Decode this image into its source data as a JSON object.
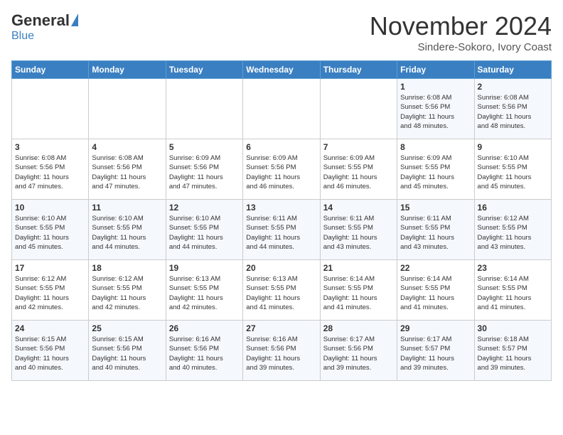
{
  "header": {
    "logo_general": "General",
    "logo_blue": "Blue",
    "month_title": "November 2024",
    "location": "Sindere-Sokoro, Ivory Coast"
  },
  "days_of_week": [
    "Sunday",
    "Monday",
    "Tuesday",
    "Wednesday",
    "Thursday",
    "Friday",
    "Saturday"
  ],
  "weeks": [
    [
      {
        "day": "",
        "info": ""
      },
      {
        "day": "",
        "info": ""
      },
      {
        "day": "",
        "info": ""
      },
      {
        "day": "",
        "info": ""
      },
      {
        "day": "",
        "info": ""
      },
      {
        "day": "1",
        "info": "Sunrise: 6:08 AM\nSunset: 5:56 PM\nDaylight: 11 hours\nand 48 minutes."
      },
      {
        "day": "2",
        "info": "Sunrise: 6:08 AM\nSunset: 5:56 PM\nDaylight: 11 hours\nand 48 minutes."
      }
    ],
    [
      {
        "day": "3",
        "info": "Sunrise: 6:08 AM\nSunset: 5:56 PM\nDaylight: 11 hours\nand 47 minutes."
      },
      {
        "day": "4",
        "info": "Sunrise: 6:08 AM\nSunset: 5:56 PM\nDaylight: 11 hours\nand 47 minutes."
      },
      {
        "day": "5",
        "info": "Sunrise: 6:09 AM\nSunset: 5:56 PM\nDaylight: 11 hours\nand 47 minutes."
      },
      {
        "day": "6",
        "info": "Sunrise: 6:09 AM\nSunset: 5:56 PM\nDaylight: 11 hours\nand 46 minutes."
      },
      {
        "day": "7",
        "info": "Sunrise: 6:09 AM\nSunset: 5:55 PM\nDaylight: 11 hours\nand 46 minutes."
      },
      {
        "day": "8",
        "info": "Sunrise: 6:09 AM\nSunset: 5:55 PM\nDaylight: 11 hours\nand 45 minutes."
      },
      {
        "day": "9",
        "info": "Sunrise: 6:10 AM\nSunset: 5:55 PM\nDaylight: 11 hours\nand 45 minutes."
      }
    ],
    [
      {
        "day": "10",
        "info": "Sunrise: 6:10 AM\nSunset: 5:55 PM\nDaylight: 11 hours\nand 45 minutes."
      },
      {
        "day": "11",
        "info": "Sunrise: 6:10 AM\nSunset: 5:55 PM\nDaylight: 11 hours\nand 44 minutes."
      },
      {
        "day": "12",
        "info": "Sunrise: 6:10 AM\nSunset: 5:55 PM\nDaylight: 11 hours\nand 44 minutes."
      },
      {
        "day": "13",
        "info": "Sunrise: 6:11 AM\nSunset: 5:55 PM\nDaylight: 11 hours\nand 44 minutes."
      },
      {
        "day": "14",
        "info": "Sunrise: 6:11 AM\nSunset: 5:55 PM\nDaylight: 11 hours\nand 43 minutes."
      },
      {
        "day": "15",
        "info": "Sunrise: 6:11 AM\nSunset: 5:55 PM\nDaylight: 11 hours\nand 43 minutes."
      },
      {
        "day": "16",
        "info": "Sunrise: 6:12 AM\nSunset: 5:55 PM\nDaylight: 11 hours\nand 43 minutes."
      }
    ],
    [
      {
        "day": "17",
        "info": "Sunrise: 6:12 AM\nSunset: 5:55 PM\nDaylight: 11 hours\nand 42 minutes."
      },
      {
        "day": "18",
        "info": "Sunrise: 6:12 AM\nSunset: 5:55 PM\nDaylight: 11 hours\nand 42 minutes."
      },
      {
        "day": "19",
        "info": "Sunrise: 6:13 AM\nSunset: 5:55 PM\nDaylight: 11 hours\nand 42 minutes."
      },
      {
        "day": "20",
        "info": "Sunrise: 6:13 AM\nSunset: 5:55 PM\nDaylight: 11 hours\nand 41 minutes."
      },
      {
        "day": "21",
        "info": "Sunrise: 6:14 AM\nSunset: 5:55 PM\nDaylight: 11 hours\nand 41 minutes."
      },
      {
        "day": "22",
        "info": "Sunrise: 6:14 AM\nSunset: 5:55 PM\nDaylight: 11 hours\nand 41 minutes."
      },
      {
        "day": "23",
        "info": "Sunrise: 6:14 AM\nSunset: 5:55 PM\nDaylight: 11 hours\nand 41 minutes."
      }
    ],
    [
      {
        "day": "24",
        "info": "Sunrise: 6:15 AM\nSunset: 5:56 PM\nDaylight: 11 hours\nand 40 minutes."
      },
      {
        "day": "25",
        "info": "Sunrise: 6:15 AM\nSunset: 5:56 PM\nDaylight: 11 hours\nand 40 minutes."
      },
      {
        "day": "26",
        "info": "Sunrise: 6:16 AM\nSunset: 5:56 PM\nDaylight: 11 hours\nand 40 minutes."
      },
      {
        "day": "27",
        "info": "Sunrise: 6:16 AM\nSunset: 5:56 PM\nDaylight: 11 hours\nand 39 minutes."
      },
      {
        "day": "28",
        "info": "Sunrise: 6:17 AM\nSunset: 5:56 PM\nDaylight: 11 hours\nand 39 minutes."
      },
      {
        "day": "29",
        "info": "Sunrise: 6:17 AM\nSunset: 5:57 PM\nDaylight: 11 hours\nand 39 minutes."
      },
      {
        "day": "30",
        "info": "Sunrise: 6:18 AM\nSunset: 5:57 PM\nDaylight: 11 hours\nand 39 minutes."
      }
    ]
  ]
}
